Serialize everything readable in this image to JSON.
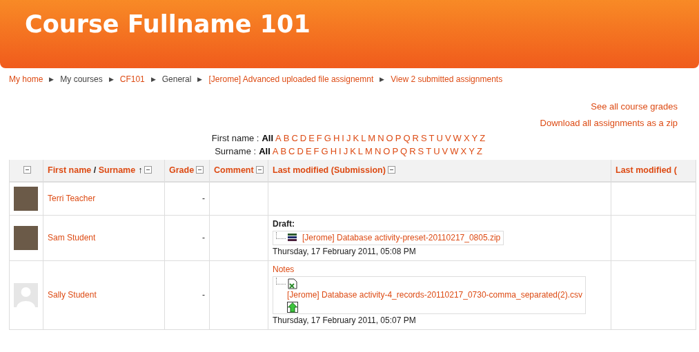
{
  "header": {
    "title": "Course Fullname 101"
  },
  "breadcrumb": [
    {
      "label": "My home",
      "kind": "link"
    },
    {
      "separator_before": "▶",
      "label": "My courses",
      "kind": "text"
    },
    {
      "separator_before": "▶",
      "label": "CF101",
      "kind": "link"
    },
    {
      "separator_before": "▶",
      "label": "General",
      "kind": "text"
    },
    {
      "separator_before": "▶",
      "label": "[Jerome] Advanced uploaded file assignemnt",
      "kind": "link"
    },
    {
      "separator_before": "▶",
      "label": "View 2 submitted assignments",
      "kind": "link"
    }
  ],
  "actions": [
    "See all course grades",
    "Download all assignments as a zip"
  ],
  "initials_bars": [
    {
      "label": "First name :",
      "items": [
        {
          "label": "All",
          "selected": true
        },
        {
          "label": "A",
          "selected": false
        },
        {
          "label": "B",
          "selected": false
        },
        {
          "label": "C",
          "selected": false
        },
        {
          "label": "D",
          "selected": false
        },
        {
          "label": "E",
          "selected": false
        },
        {
          "label": "F",
          "selected": false
        },
        {
          "label": "G",
          "selected": false
        },
        {
          "label": "H",
          "selected": false
        },
        {
          "label": "I",
          "selected": false
        },
        {
          "label": "J",
          "selected": false
        },
        {
          "label": "K",
          "selected": false
        },
        {
          "label": "L",
          "selected": false
        },
        {
          "label": "M",
          "selected": false
        },
        {
          "label": "N",
          "selected": false
        },
        {
          "label": "O",
          "selected": false
        },
        {
          "label": "P",
          "selected": false
        },
        {
          "label": "Q",
          "selected": false
        },
        {
          "label": "R",
          "selected": false
        },
        {
          "label": "S",
          "selected": false
        },
        {
          "label": "T",
          "selected": false
        },
        {
          "label": "U",
          "selected": false
        },
        {
          "label": "V",
          "selected": false
        },
        {
          "label": "W",
          "selected": false
        },
        {
          "label": "X",
          "selected": false
        },
        {
          "label": "Y",
          "selected": false
        },
        {
          "label": "Z",
          "selected": false
        }
      ]
    },
    {
      "label": "Surname :",
      "items": [
        {
          "label": "All",
          "selected": true
        },
        {
          "label": "A",
          "selected": false
        },
        {
          "label": "B",
          "selected": false
        },
        {
          "label": "C",
          "selected": false
        },
        {
          "label": "D",
          "selected": false
        },
        {
          "label": "E",
          "selected": false
        },
        {
          "label": "F",
          "selected": false
        },
        {
          "label": "G",
          "selected": false
        },
        {
          "label": "H",
          "selected": false
        },
        {
          "label": "I",
          "selected": false
        },
        {
          "label": "J",
          "selected": false
        },
        {
          "label": "K",
          "selected": false
        },
        {
          "label": "L",
          "selected": false
        },
        {
          "label": "M",
          "selected": false
        },
        {
          "label": "N",
          "selected": false
        },
        {
          "label": "O",
          "selected": false
        },
        {
          "label": "P",
          "selected": false
        },
        {
          "label": "Q",
          "selected": false
        },
        {
          "label": "R",
          "selected": false
        },
        {
          "label": "S",
          "selected": false
        },
        {
          "label": "T",
          "selected": false
        },
        {
          "label": "U",
          "selected": false
        },
        {
          "label": "V",
          "selected": false
        },
        {
          "label": "W",
          "selected": false
        },
        {
          "label": "X",
          "selected": false
        },
        {
          "label": "Y",
          "selected": false
        },
        {
          "label": "Z",
          "selected": false
        }
      ]
    }
  ],
  "table": {
    "columns": [
      {
        "collapsible": true
      },
      {
        "labels": [
          "First name",
          "Surname"
        ],
        "separator": "/",
        "sort_arrow": "↑",
        "collapsible": true
      },
      {
        "labels": [
          "Grade"
        ],
        "collapsible": true
      },
      {
        "labels": [
          "Comment"
        ],
        "collapsible": true
      },
      {
        "labels": [
          "Last modified (Submission)"
        ],
        "collapsible": true
      },
      {
        "labels": [
          "Last modified ("
        ],
        "collapsible": false
      }
    ],
    "rows": [
      {
        "avatar": {
          "kind": "photo"
        },
        "name": "Terri Teacher",
        "grade": "-"
      },
      {
        "avatar": {
          "kind": "photo"
        },
        "name": "Sam Student",
        "grade": "-",
        "submission": {
          "label": {
            "kind": "text",
            "text": "Draft:"
          },
          "file": {
            "kind": "archive",
            "name": "[Jerome] Database activity-preset-20110217_0805.zip"
          },
          "upload_icon": false,
          "date": "Thursday, 17 February 2011, 05:08 PM"
        }
      },
      {
        "avatar": {
          "kind": "default"
        },
        "name": "Sally Student",
        "grade": "-",
        "submission": {
          "label": {
            "kind": "link",
            "text": "Notes"
          },
          "file": {
            "kind": "spreadsheet",
            "name": "[Jerome] Database activity-4_records-20110217_0730-comma_separated(2).csv"
          },
          "upload_icon": true,
          "date": "Thursday, 17 February 2011, 05:07 PM"
        }
      }
    ]
  }
}
